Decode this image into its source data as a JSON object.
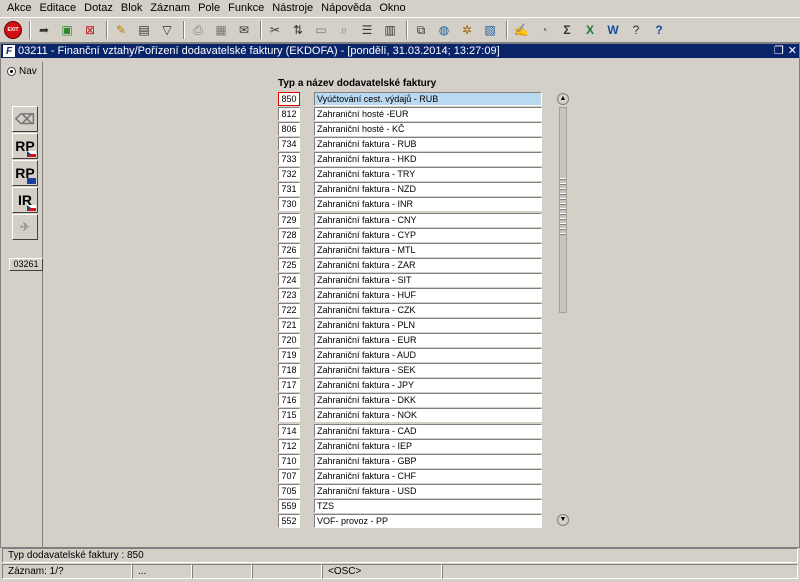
{
  "menu": [
    "Akce",
    "Editace",
    "Dotaz",
    "Blok",
    "Záznam",
    "Pole",
    "Funkce",
    "Nástroje",
    "Nápověda",
    "Okno"
  ],
  "toolbar": {
    "exit_label": "EXIT",
    "icons": [
      "exit-icon",
      "forward-icon",
      "insert-record-icon",
      "delete-record-icon",
      "enter-query-icon",
      "execute-query-icon",
      "filter-icon",
      "print-icon",
      "report-icon",
      "mail-icon",
      "cut-icon",
      "copy-icon",
      "paste-icon",
      "find-icon",
      "list-icon",
      "calendar-icon",
      "tree-icon",
      "globe-icon",
      "settings-icon",
      "notes-icon",
      "attachment-icon",
      "calculator-icon",
      "sum-icon",
      "excel-icon",
      "word-icon",
      "help-topic-icon",
      "help-icon"
    ],
    "sum_glyph": "Σ"
  },
  "window": {
    "title": "03211 - Finanční vztahy/Pořízení dodavatelské faktury (EKDOFA) - [pondělí, 31.03.2014; 13:27:09]",
    "icon_letter": "F",
    "restore_glyph": "❐",
    "close_glyph": "✕"
  },
  "leftpanel": {
    "nav_label": "Nav",
    "buttons": [
      {
        "label": "",
        "icon": "eraser-icon"
      },
      {
        "label": "RP",
        "icon": "czech-flag-icon"
      },
      {
        "label": "RP",
        "icon": "eu-flag-icon"
      },
      {
        "label": "IR",
        "icon": "czech-flag-icon"
      },
      {
        "label": "",
        "icon": "sps-icon"
      }
    ],
    "code": "03261"
  },
  "list": {
    "header": "Typ a název dodavatelské faktury",
    "rows": [
      {
        "code": "850",
        "name": "Vyúčtování cest. výdajů - RUB"
      },
      {
        "code": "812",
        "name": "Zahraniční hosté -EUR"
      },
      {
        "code": "806",
        "name": "Zahraniční hosté - KČ"
      },
      {
        "code": "734",
        "name": "Zahraniční faktura - RUB"
      },
      {
        "code": "733",
        "name": "Zahraniční faktura - HKD"
      },
      {
        "code": "732",
        "name": "Zahraniční faktura - TRY"
      },
      {
        "code": "731",
        "name": "Zahraniční faktura - NZD"
      },
      {
        "code": "730",
        "name": "Zahraniční faktura - INR"
      },
      {
        "code": "729",
        "name": "Zahraniční faktura - CNY"
      },
      {
        "code": "728",
        "name": "Zahraniční faktura - CYP"
      },
      {
        "code": "726",
        "name": "Zahraniční faktura - MTL"
      },
      {
        "code": "725",
        "name": "Zahraniční faktura - ZAR"
      },
      {
        "code": "724",
        "name": "Zahraniční faktura - SIT"
      },
      {
        "code": "723",
        "name": "Zahraniční faktura - HUF"
      },
      {
        "code": "722",
        "name": "Zahraniční faktura - CZK"
      },
      {
        "code": "721",
        "name": "Zahraniční faktura - PLN"
      },
      {
        "code": "720",
        "name": "Zahraniční faktura - EUR"
      },
      {
        "code": "719",
        "name": "Zahraniční faktura - AUD"
      },
      {
        "code": "718",
        "name": "Zahraniční faktura - SEK"
      },
      {
        "code": "717",
        "name": "Zahraniční faktura - JPY"
      },
      {
        "code": "716",
        "name": "Zahraniční faktura - DKK"
      },
      {
        "code": "715",
        "name": "Zahraniční faktura - NOK"
      },
      {
        "code": "714",
        "name": "Zahraniční faktura - CAD"
      },
      {
        "code": "712",
        "name": "Zahraniční faktura - IEP"
      },
      {
        "code": "710",
        "name": "Zahraniční faktura - GBP"
      },
      {
        "code": "707",
        "name": "Zahraniční faktura - CHF"
      },
      {
        "code": "705",
        "name": "Zahraniční faktura - USD"
      },
      {
        "code": "559",
        "name": "TZS"
      },
      {
        "code": "552",
        "name": "VOF- provoz - PP"
      }
    ],
    "active_index": 0
  },
  "status": {
    "line1": "Typ dodavatelské faktury : 850",
    "record": "Záznam: 1/?",
    "seg2": "...",
    "seg3": "",
    "seg4": "",
    "mode": "<OSC>",
    "seg6": ""
  }
}
